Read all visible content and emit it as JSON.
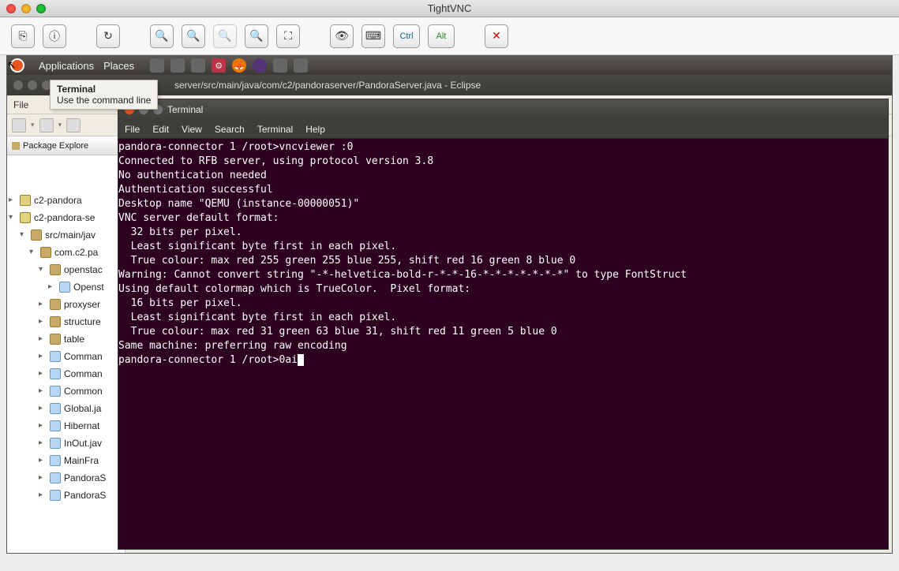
{
  "mac": {
    "title": "TightVNC"
  },
  "vnc_toolbar": {
    "icons": [
      "new-connection",
      "options",
      "refresh",
      "zoom-in",
      "zoom-out",
      "zoom-actual",
      "zoom-fit",
      "fullscreen",
      "toggle-remote-cursor",
      "send-keys",
      "ctrl",
      "alt",
      "close"
    ]
  },
  "ubuntu": {
    "menus": [
      "Applications",
      "Places"
    ]
  },
  "tooltip": {
    "title": "Terminal",
    "desc": "Use the command line"
  },
  "eclipse": {
    "title_suffix": "server/src/main/java/com/c2/pandoraserver/PandoraServer.java - Eclipse",
    "menu_visible": [
      "File"
    ],
    "pkg_explorer_title": "Package Explore",
    "tree": [
      {
        "lvl": 0,
        "arr": "▸",
        "ic": "prj",
        "label": "c2-pandora"
      },
      {
        "lvl": 0,
        "arr": "▾",
        "ic": "prj",
        "label": "c2-pandora-se"
      },
      {
        "lvl": 1,
        "arr": "▾",
        "ic": "pkg",
        "label": "src/main/jav"
      },
      {
        "lvl": 2,
        "arr": "▾",
        "ic": "pkg",
        "label": "com.c2.pa"
      },
      {
        "lvl": 3,
        "arr": "▾",
        "ic": "pkg",
        "label": "openstac"
      },
      {
        "lvl": 4,
        "arr": "▸",
        "ic": "cls",
        "label": "Openst"
      },
      {
        "lvl": 3,
        "arr": "▸",
        "ic": "pkg",
        "label": "proxyser"
      },
      {
        "lvl": 3,
        "arr": "▸",
        "ic": "pkg",
        "label": "structure"
      },
      {
        "lvl": 3,
        "arr": "▸",
        "ic": "pkg",
        "label": "table"
      },
      {
        "lvl": 3,
        "arr": "▸",
        "ic": "cls",
        "label": "Comman"
      },
      {
        "lvl": 3,
        "arr": "▸",
        "ic": "cls",
        "label": "Comman"
      },
      {
        "lvl": 3,
        "arr": "▸",
        "ic": "cls",
        "label": "Common"
      },
      {
        "lvl": 3,
        "arr": "▸",
        "ic": "cls",
        "label": "Global.ja"
      },
      {
        "lvl": 3,
        "arr": "▸",
        "ic": "cls",
        "label": "Hibernat"
      },
      {
        "lvl": 3,
        "arr": "▸",
        "ic": "cls",
        "label": "InOut.jav"
      },
      {
        "lvl": 3,
        "arr": "▸",
        "ic": "cls",
        "label": "MainFra"
      },
      {
        "lvl": 3,
        "arr": "▸",
        "ic": "cls",
        "label": "PandoraS"
      },
      {
        "lvl": 3,
        "arr": "▸",
        "ic": "cls",
        "label": "PandoraS"
      }
    ]
  },
  "terminal": {
    "title": "Terminal",
    "menus": [
      "File",
      "Edit",
      "View",
      "Search",
      "Terminal",
      "Help"
    ],
    "lines": [
      "pandora-connector 1 /root>vncviewer :0",
      "Connected to RFB server, using protocol version 3.8",
      "No authentication needed",
      "Authentication successful",
      "Desktop name \"QEMU (instance-00000051)\"",
      "VNC server default format:",
      "  32 bits per pixel.",
      "  Least significant byte first in each pixel.",
      "  True colour: max red 255 green 255 blue 255, shift red 16 green 8 blue 0",
      "Warning: Cannot convert string \"-*-helvetica-bold-r-*-*-16-*-*-*-*-*-*-*\" to type FontStruct",
      "Using default colormap which is TrueColor.  Pixel format:",
      "  16 bits per pixel.",
      "  Least significant byte first in each pixel.",
      "  True colour: max red 31 green 63 blue 31, shift red 11 green 5 blue 0",
      "Same machine: preferring raw encoding"
    ],
    "prompt": "pandora-connector 1 /root>0ai"
  }
}
